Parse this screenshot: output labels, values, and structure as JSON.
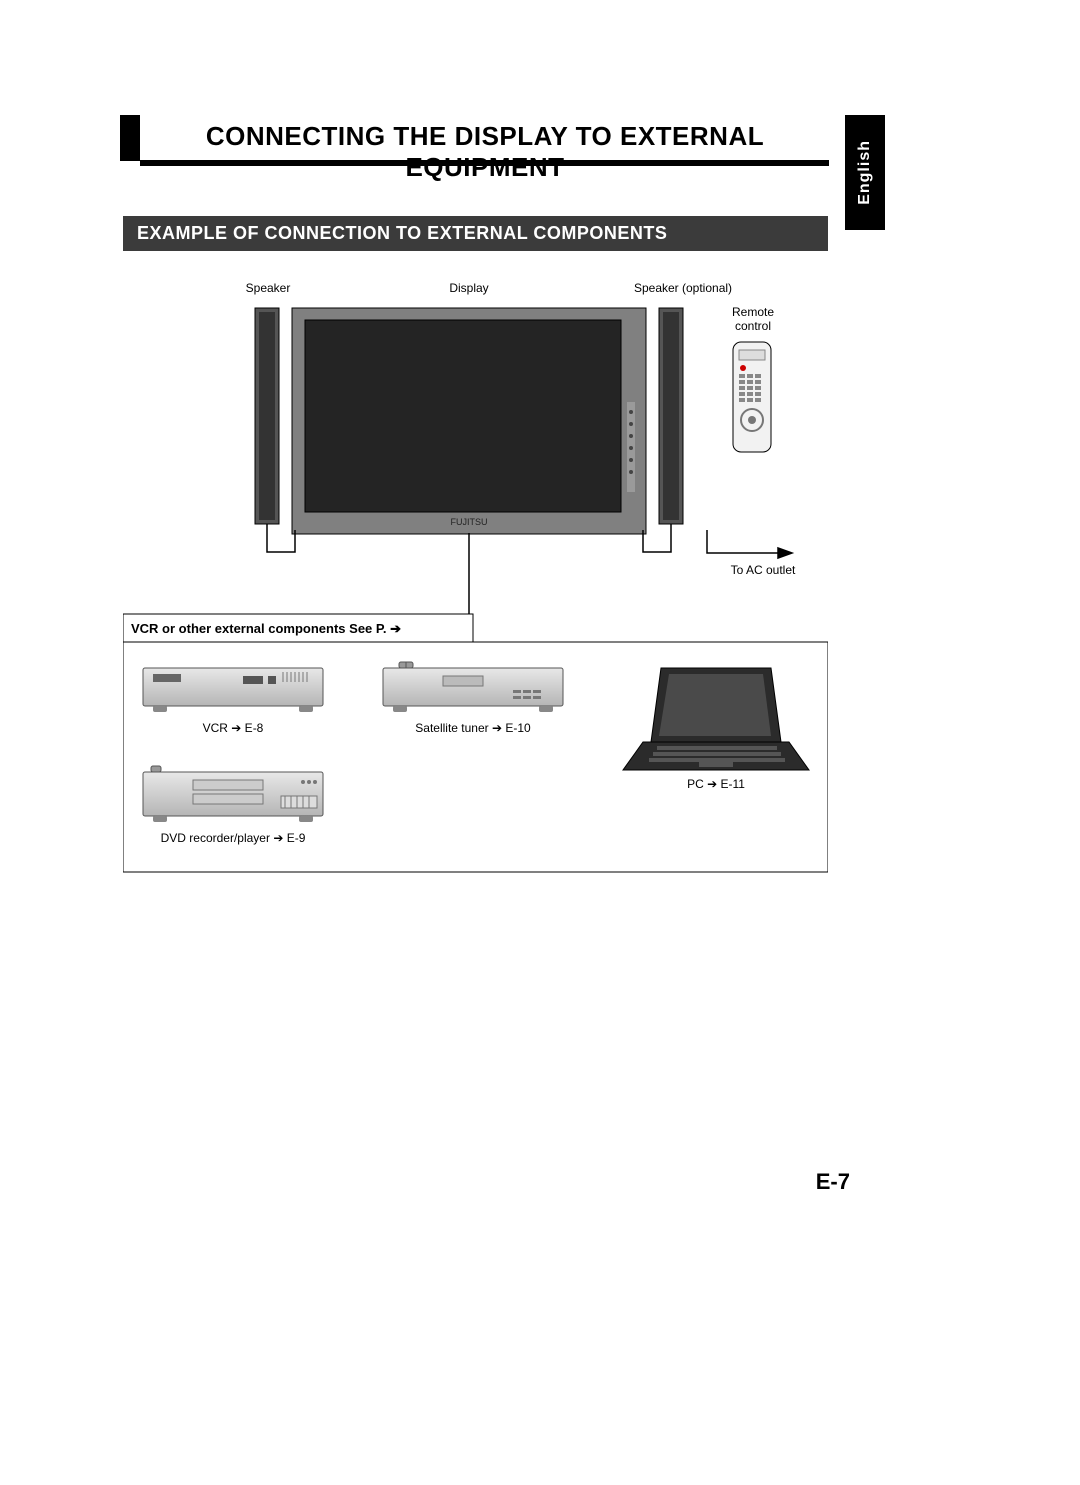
{
  "language_tab": "English",
  "title": "CONNECTING THE DISPLAY TO EXTERNAL EQUIPMENT",
  "section": "EXAMPLE OF CONNECTION TO EXTERNAL COMPONENTS",
  "diagram": {
    "labels": {
      "speaker": "Speaker",
      "display": "Display",
      "speaker_optional": "Speaker (optional)",
      "remote_line1": "Remote",
      "remote_line2": "control",
      "ac_outlet": "To AC outlet",
      "brand": "FUJITSU"
    },
    "box_title": "VCR or other external components See P. ➔",
    "components": {
      "vcr": "VCR ➔ E-8",
      "satellite": "Satellite tuner ➔ E-10",
      "dvd": "DVD recorder/player ➔ E-9",
      "pc": "PC ➔ E-11"
    }
  },
  "page_number": "E-7"
}
